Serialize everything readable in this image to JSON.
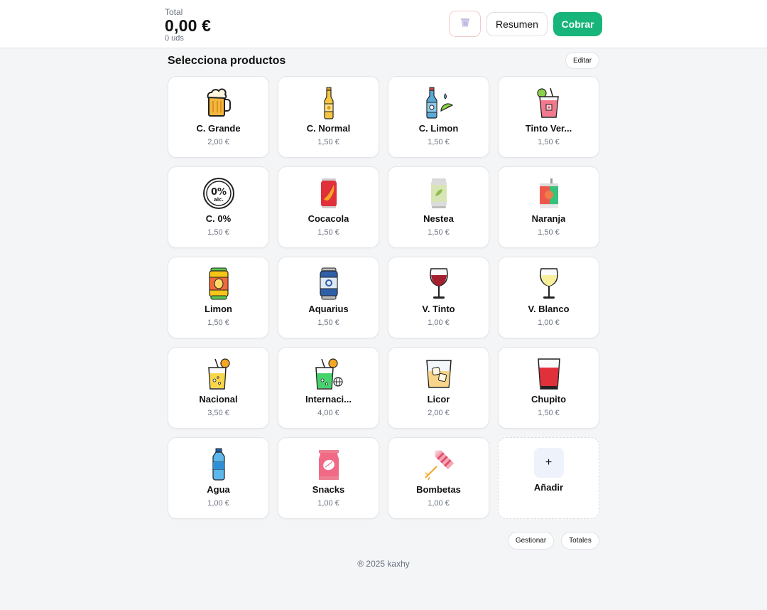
{
  "header": {
    "total_label": "Total",
    "total_amount": "0,00 €",
    "total_units": "0 uds",
    "summary_label": "Resumen",
    "charge_label": "Cobrar"
  },
  "section": {
    "title": "Selecciona productos",
    "edit_label": "Editar"
  },
  "products": [
    {
      "name": "C. Grande",
      "price": "2,00 €",
      "icon": "beer-mug-icon"
    },
    {
      "name": "C. Normal",
      "price": "1,50 €",
      "icon": "beer-bottle-icon"
    },
    {
      "name": "C. Limon",
      "price": "1,50 €",
      "icon": "lemon-beer-icon"
    },
    {
      "name": "Tinto Ver...",
      "price": "1,50 €",
      "icon": "tinto-de-verano-icon"
    },
    {
      "name": "C. 0%",
      "price": "1,50 €",
      "icon": "zero-alcohol-icon"
    },
    {
      "name": "Cocacola",
      "price": "1,50 €",
      "icon": "cola-can-icon"
    },
    {
      "name": "Nestea",
      "price": "1,50 €",
      "icon": "iced-tea-can-icon"
    },
    {
      "name": "Naranja",
      "price": "1,50 €",
      "icon": "orange-juice-icon"
    },
    {
      "name": "Limon",
      "price": "1,50 €",
      "icon": "lemon-soda-can-icon"
    },
    {
      "name": "Aquarius",
      "price": "1,50 €",
      "icon": "sports-drink-can-icon"
    },
    {
      "name": "V. Tinto",
      "price": "1,00 €",
      "icon": "red-wine-glass-icon"
    },
    {
      "name": "V. Blanco",
      "price": "1,00 €",
      "icon": "white-wine-glass-icon"
    },
    {
      "name": "Nacional",
      "price": "3,50 €",
      "icon": "cocktail-glass-icon"
    },
    {
      "name": "Internaci...",
      "price": "4,00 €",
      "icon": "international-cocktail-icon"
    },
    {
      "name": "Licor",
      "price": "2,00 €",
      "icon": "liquor-glass-icon"
    },
    {
      "name": "Chupito",
      "price": "1,50 €",
      "icon": "shot-glass-icon"
    },
    {
      "name": "Agua",
      "price": "1,00 €",
      "icon": "water-bottle-icon"
    },
    {
      "name": "Snacks",
      "price": "1,00 €",
      "icon": "snack-bag-icon"
    },
    {
      "name": "Bombetas",
      "price": "1,00 €",
      "icon": "firework-icon"
    }
  ],
  "add_card": {
    "symbol": "+",
    "label": "Añadir"
  },
  "bottom": {
    "manage_label": "Gestionar",
    "totals_label": "Totales"
  },
  "footer": {
    "text": "® 2025 kaxhy"
  },
  "colors": {
    "accent": "#17b57a",
    "background": "#f4f5f7",
    "card": "#ffffff"
  }
}
